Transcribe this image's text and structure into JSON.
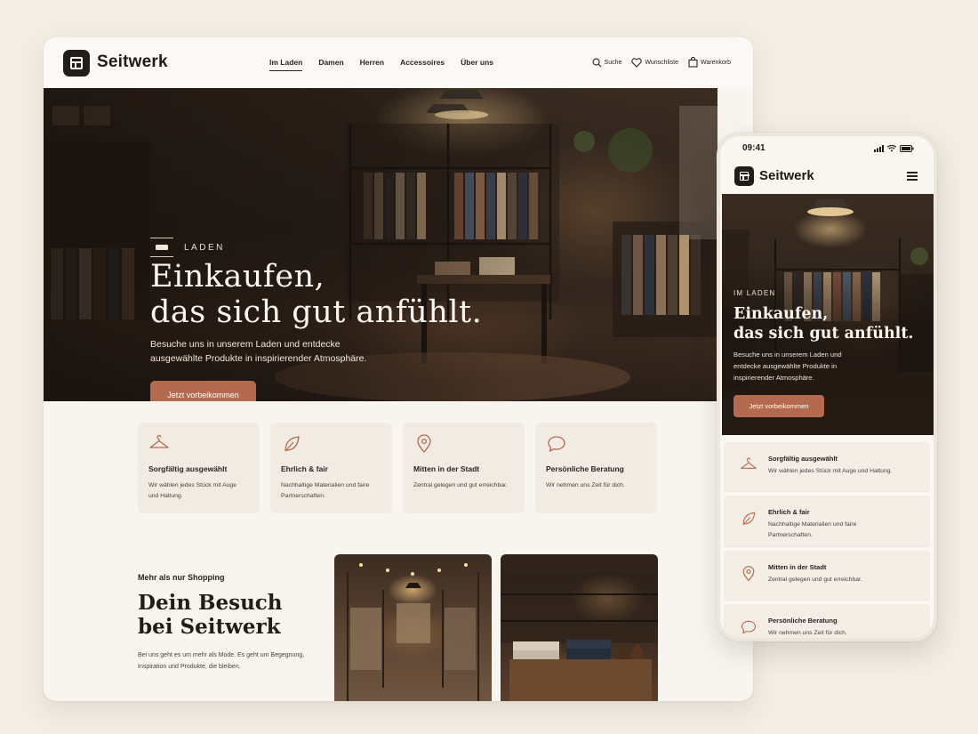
{
  "desktop": {
    "brand": "Seitwerk",
    "nav": [
      {
        "label": "Im Laden",
        "active": true
      },
      {
        "label": "Damen",
        "active": false
      },
      {
        "label": "Herren",
        "active": false
      },
      {
        "label": "Accessoires",
        "active": false
      },
      {
        "label": "Über uns",
        "active": false
      }
    ],
    "actions": {
      "search": "Suche",
      "wishlist": "Wunschliste",
      "cart": "Warenkorb"
    },
    "hero": {
      "eyebrow": "LADEN",
      "title_line1": "Einkaufen,",
      "title_line2": "das sich gut anfühlt.",
      "text": "Besuche uns in unserem Laden und entdecke ausgewählte Produkte in inspirierender Atmosphäre.",
      "cta": "Jetzt vorbeikommen"
    },
    "features": [
      {
        "icon": "hanger-icon",
        "title": "Sorgfältig ausgewählt",
        "text": "Wir wählen jedes Stück mit Auge und Haltung."
      },
      {
        "icon": "leaf-icon",
        "title": "Ehrlich & fair",
        "text": "Nachhaltige Materialien und faire Partnerschaften."
      },
      {
        "icon": "location-pin-icon",
        "title": "Mitten in der Stadt",
        "text": "Zentral gelegen und gut erreichbar."
      },
      {
        "icon": "chat-bubble-icon",
        "title": "Persönliche Beratung",
        "text": "Wir nehmen uns Zeit für dich."
      }
    ],
    "visit": {
      "eyebrow": "Mehr als nur Shopping",
      "title_line1": "Dein Besuch",
      "title_line2": "bei Seitwerk",
      "text": "Bei uns geht es um mehr als Mode. Es geht um Begegnung, Inspiration und Produkte, die bleiben."
    }
  },
  "mobile": {
    "time": "09:41",
    "brand": "Seitwerk",
    "hero": {
      "eyebrow": "IM LADEN",
      "title_line1": "Einkaufen,",
      "title_line2": "das sich gut anfühlt.",
      "text": "Besuche uns in unserem Laden und entdecke ausgewählte Produkte in inspirierender Atmosphäre.",
      "cta": "Jetzt vorbeikommen"
    },
    "features": [
      {
        "icon": "hanger-icon",
        "title": "Sorgfältig ausgewählt",
        "text": "Wir wählen jedes Stück mit Auge und Haltung."
      },
      {
        "icon": "leaf-icon",
        "title": "Ehrlich & fair",
        "text": "Nachhaltige Materialien und faire Partnerschaften."
      },
      {
        "icon": "location-pin-icon",
        "title": "Mitten in der Stadt",
        "text": "Zentral gelegen und gut erreichbar."
      },
      {
        "icon": "chat-bubble-icon",
        "title": "Persönliche Beratung",
        "text": "Wir nehmen uns Zeit für dich."
      }
    ]
  },
  "colors": {
    "background": "#f3ede4",
    "accent": "#b46a4e",
    "dark": "#231d19"
  }
}
